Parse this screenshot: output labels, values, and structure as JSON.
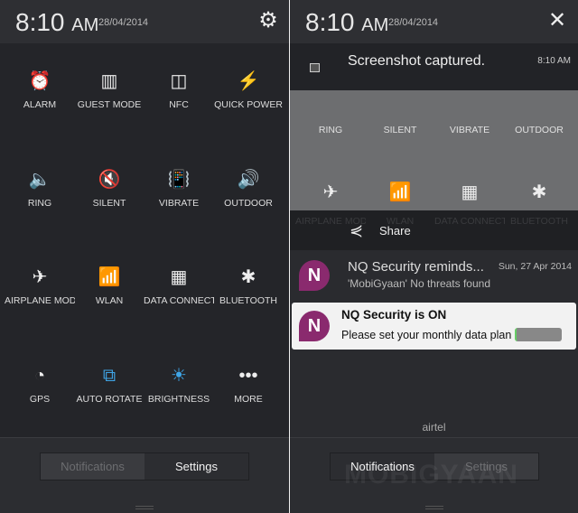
{
  "left": {
    "time": "8:10",
    "ampm": "AM",
    "date": "28/04/2014",
    "settings_icon": "gear-icon",
    "tiles": [
      {
        "label": "ALARM",
        "icon": "⏰",
        "active": false
      },
      {
        "label": "GUEST MODE",
        "icon": "▥",
        "active": false
      },
      {
        "label": "NFC",
        "icon": "◫",
        "active": false
      },
      {
        "label": "QUICK POWER",
        "icon": "⚡",
        "active": false
      },
      {
        "label": "RING",
        "icon": "🔈",
        "active": true
      },
      {
        "label": "SILENT",
        "icon": "🔇",
        "active": false
      },
      {
        "label": "VIBRATE",
        "icon": "📳",
        "active": false
      },
      {
        "label": "OUTDOOR",
        "icon": "🔊",
        "active": false
      },
      {
        "label": "AIRPLANE MODE",
        "icon": "✈",
        "active": false
      },
      {
        "label": "WLAN",
        "icon": "📶",
        "active": true
      },
      {
        "label": "DATA CONNECTION",
        "icon": "▦",
        "active": false
      },
      {
        "label": "BLUETOOTH",
        "icon": "✱",
        "active": false
      },
      {
        "label": "GPS",
        "icon": "◔",
        "active": false
      },
      {
        "label": "AUTO ROTATE",
        "icon": "⧉",
        "active": true
      },
      {
        "label": "BRIGHTNESS",
        "icon": "☀",
        "active": true
      },
      {
        "label": "MORE",
        "icon": "•••",
        "active": false
      }
    ],
    "tabs": {
      "notifications": "Notifications",
      "settings": "Settings"
    },
    "selected_tab": "Settings"
  },
  "right": {
    "time": "8:10",
    "ampm": "AM",
    "date": "28/04/2014",
    "close_icon": "close-icon",
    "screenshot": {
      "title": "Screenshot captured.",
      "time": "8:10 AM",
      "share": "Share"
    },
    "row_labels": [
      "RING",
      "SILENT",
      "VIBRATE",
      "OUTDOOR"
    ],
    "row2_icons": [
      "✈",
      "📶",
      "▦",
      "✱"
    ],
    "faded_labels": [
      "AIRPLANE MODE",
      "WLAN",
      "DATA CONNECTION",
      "BLUETOOTH"
    ],
    "nq_notification": {
      "title": "NQ Security reminds...",
      "date": "Sun, 27 Apr 2014",
      "text": "'MobiGyaan' No threats found"
    },
    "nq_card": {
      "title": "NQ Security is ON",
      "text": "Please set your monthly data plan"
    },
    "carrier": "airtel",
    "tabs": {
      "notifications": "Notifications",
      "settings": "Settings"
    },
    "selected_tab": "Notifications",
    "watermark": "MOBIGYAAN"
  }
}
